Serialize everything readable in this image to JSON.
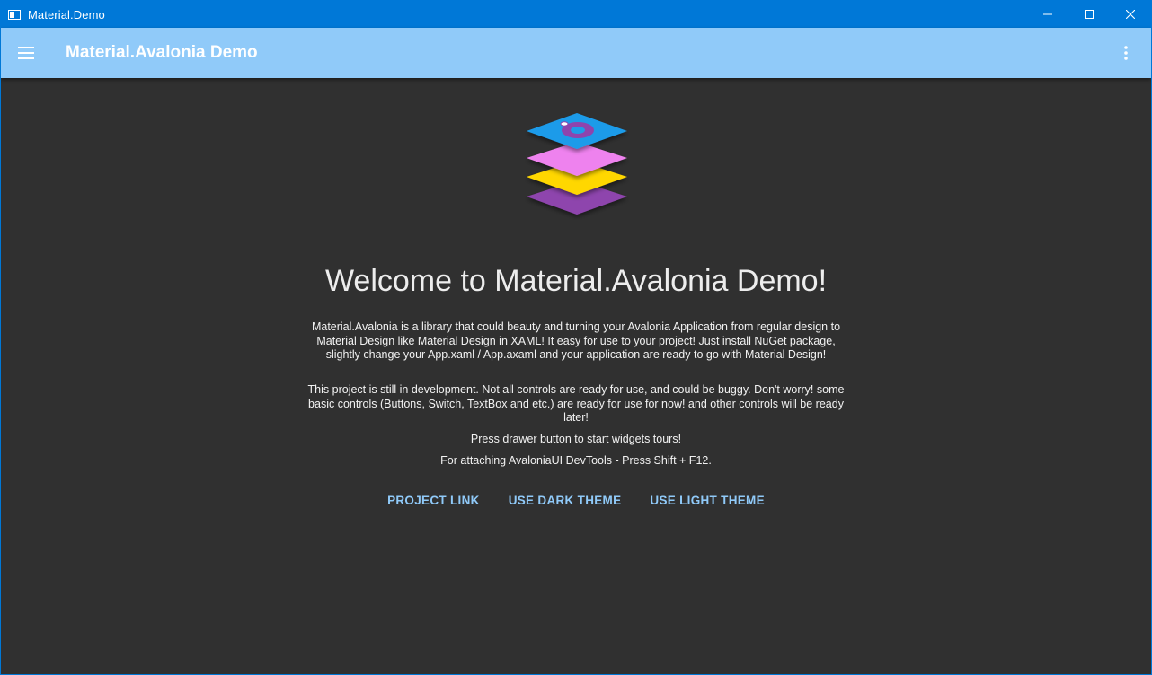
{
  "window": {
    "title": "Material.Demo"
  },
  "appbar": {
    "title": "Material.Avalonia Demo",
    "menu_icon": "hamburger-menu-icon",
    "more_icon": "more-vertical-icon"
  },
  "main": {
    "welcome": "Welcome to Material.Avalonia Demo!",
    "paragraphs": [
      "Material.Avalonia is a library that could beauty and turning your Avalonia Application from regular design to Material Design like Material Design in XAML! It easy for use to your project! Just install NuGet package, slightly change your App.xaml / App.axaml and your application are ready to go with Material Design!",
      "This project is still in development. Not all controls are ready for use, and could be buggy. Don't worry! some basic controls (Buttons, Switch, TextBox and etc.) are ready for use for now! and other controls will be ready later!",
      "Press drawer button to start widgets tours!",
      "For attaching AvaloniaUI DevTools - Press Shift + F12."
    ],
    "buttons": {
      "project_link": "PROJECT LINK",
      "dark_theme": "USE DARK THEME",
      "light_theme": "USE LIGHT THEME"
    }
  },
  "colors": {
    "titlebar": "#0078d7",
    "appbar": "#90caf9",
    "background": "#303030",
    "accent_text": "#90caf9",
    "logo_layers": [
      "#1e9be9",
      "#ee82ee",
      "#ffd700",
      "#8e44ad"
    ]
  }
}
